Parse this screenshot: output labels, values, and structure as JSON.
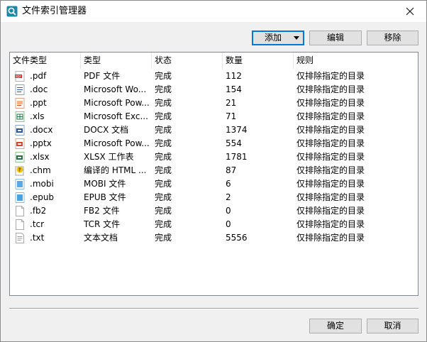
{
  "window": {
    "title": "文件索引管理器"
  },
  "toolbar": {
    "add_label": "添加",
    "edit_label": "编辑",
    "remove_label": "移除"
  },
  "table": {
    "columns": [
      "文件类型",
      "类型",
      "状态",
      "数量",
      "规则"
    ],
    "rows": [
      {
        "ext": ".pdf",
        "type": "PDF 文件",
        "status": "完成",
        "count": "112",
        "rule": "仅排除指定的目录",
        "icon": "pdf-file-icon"
      },
      {
        "ext": ".doc",
        "type": "Microsoft Wo...",
        "status": "完成",
        "count": "154",
        "rule": "仅排除指定的目录",
        "icon": "word-file-icon"
      },
      {
        "ext": ".ppt",
        "type": "Microsoft Pow...",
        "status": "完成",
        "count": "21",
        "rule": "仅排除指定的目录",
        "icon": "powerpoint-file-icon"
      },
      {
        "ext": ".xls",
        "type": "Microsoft Exc...",
        "status": "完成",
        "count": "71",
        "rule": "仅排除指定的目录",
        "icon": "excel-file-icon"
      },
      {
        "ext": ".docx",
        "type": "DOCX 文档",
        "status": "完成",
        "count": "1374",
        "rule": "仅排除指定的目录",
        "icon": "docx-file-icon"
      },
      {
        "ext": ".pptx",
        "type": "Microsoft Pow...",
        "status": "完成",
        "count": "554",
        "rule": "仅排除指定的目录",
        "icon": "pptx-file-icon"
      },
      {
        "ext": ".xlsx",
        "type": "XLSX 工作表",
        "status": "完成",
        "count": "1781",
        "rule": "仅排除指定的目录",
        "icon": "xlsx-file-icon"
      },
      {
        "ext": ".chm",
        "type": "编译的 HTML ...",
        "status": "完成",
        "count": "87",
        "rule": "仅排除指定的目录",
        "icon": "chm-help-file-icon"
      },
      {
        "ext": ".mobi",
        "type": "MOBI 文件",
        "status": "完成",
        "count": "6",
        "rule": "仅排除指定的目录",
        "icon": "mobi-file-icon"
      },
      {
        "ext": ".epub",
        "type": "EPUB 文件",
        "status": "完成",
        "count": "2",
        "rule": "仅排除指定的目录",
        "icon": "epub-file-icon"
      },
      {
        "ext": ".fb2",
        "type": "FB2 文件",
        "status": "完成",
        "count": "0",
        "rule": "仅排除指定的目录",
        "icon": "blank-file-icon"
      },
      {
        "ext": ".tcr",
        "type": "TCR 文件",
        "status": "完成",
        "count": "0",
        "rule": "仅排除指定的目录",
        "icon": "blank-file-icon"
      },
      {
        "ext": ".txt",
        "type": "文本文档",
        "status": "完成",
        "count": "5556",
        "rule": "仅排除指定的目录",
        "icon": "text-file-icon"
      }
    ]
  },
  "footer": {
    "ok_label": "确定",
    "cancel_label": "取消"
  }
}
